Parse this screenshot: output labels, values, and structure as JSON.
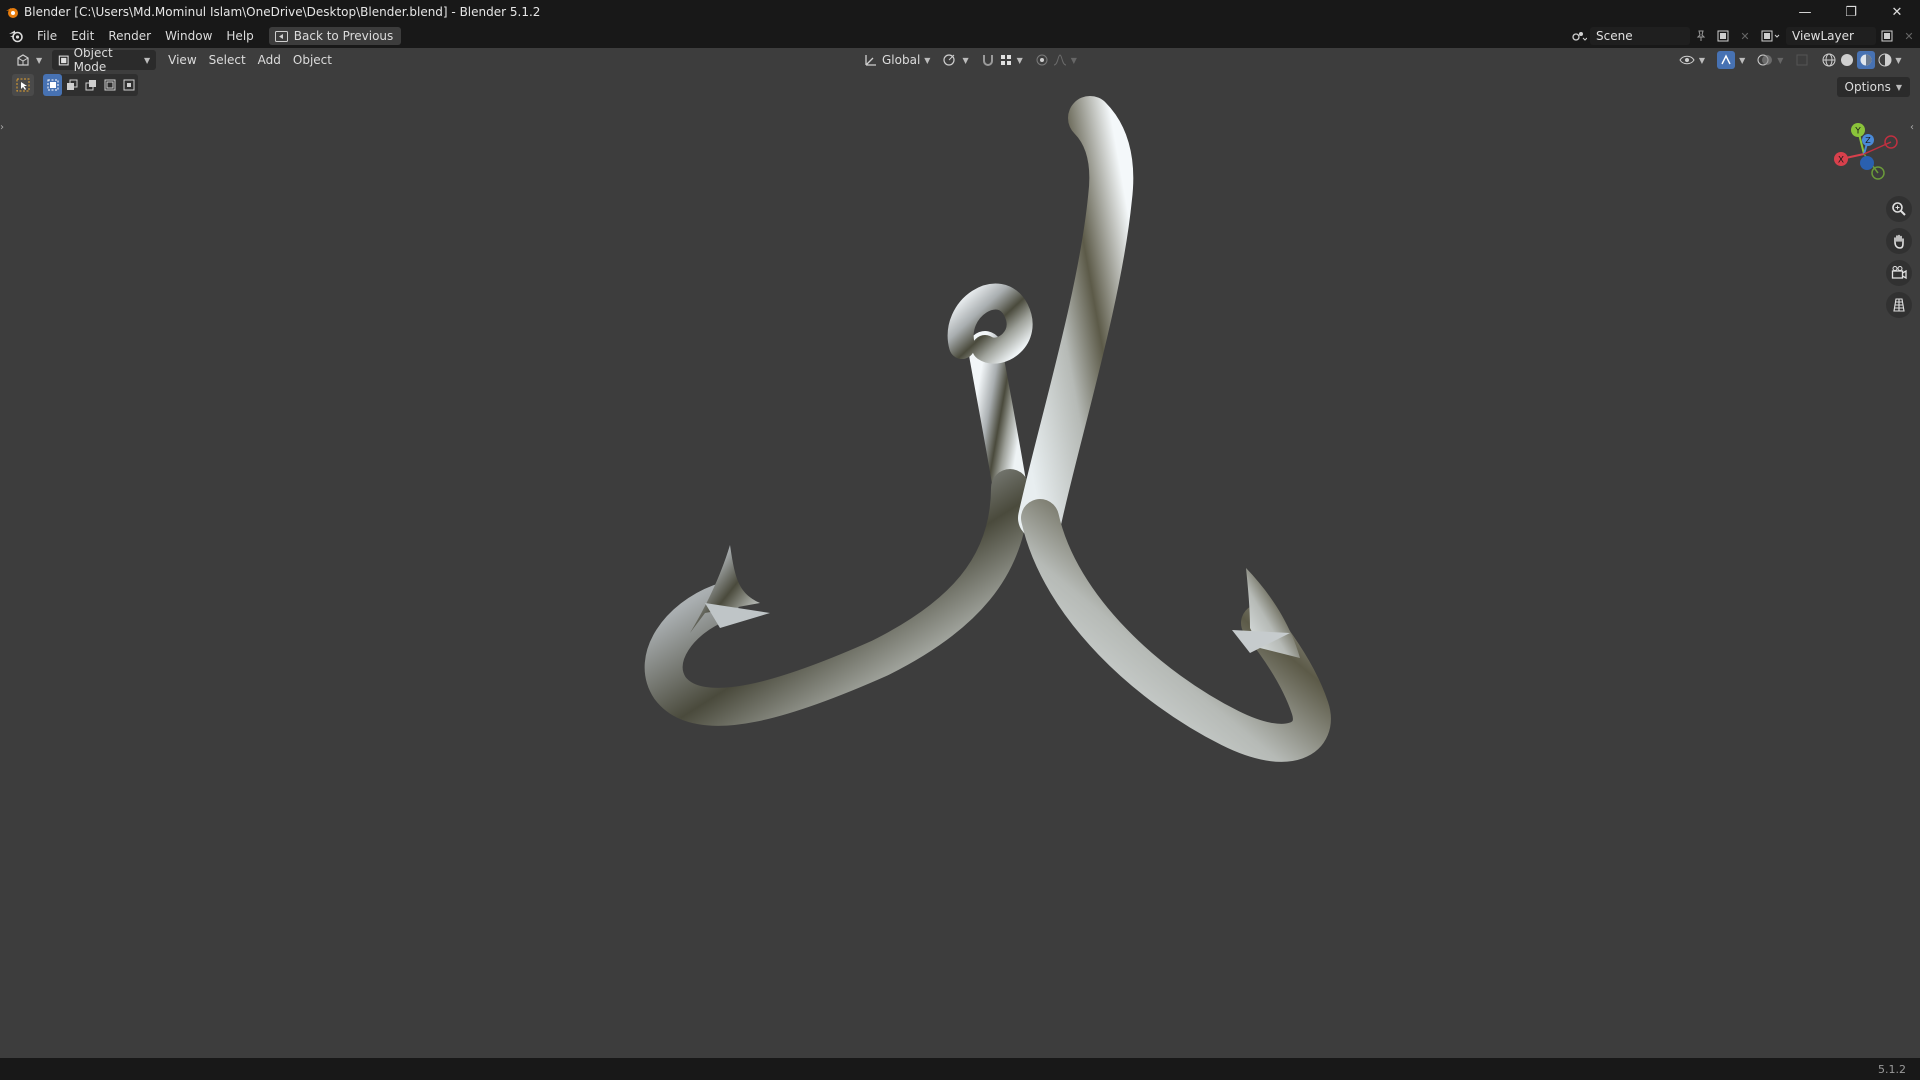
{
  "window": {
    "title": "Blender [C:\\Users\\Md.Mominul Islam\\OneDrive\\Desktop\\Blender.blend] - Blender 5.1.2",
    "controls": {
      "minimize": "—",
      "maximize": "❐",
      "close": "✕"
    }
  },
  "menu": {
    "items": [
      "File",
      "Edit",
      "Render",
      "Window",
      "Help"
    ],
    "back_label": "Back to Previous"
  },
  "scene": {
    "name": "Scene",
    "view_layer": "ViewLayer"
  },
  "viewport": {
    "mode": "Object Mode",
    "menus": [
      "View",
      "Select",
      "Add",
      "Object"
    ],
    "transform_orientation": "Global",
    "options_label": "Options",
    "gizmo_axes": {
      "x": "X",
      "y": "Y",
      "z": "Z"
    },
    "icons": {
      "editor_type": "editor-type-icon",
      "object_mode": "object-mode-icon",
      "pivot": "pivot-point-icon",
      "snap": "snap-magnet-icon",
      "proportional": "proportional-edit-icon",
      "zoom": "zoom-icon",
      "pan": "hand-icon",
      "camera": "camera-icon",
      "grid": "grid-icon"
    },
    "accent_color": "#4772b3"
  },
  "status": {
    "version": "5.1.2"
  }
}
